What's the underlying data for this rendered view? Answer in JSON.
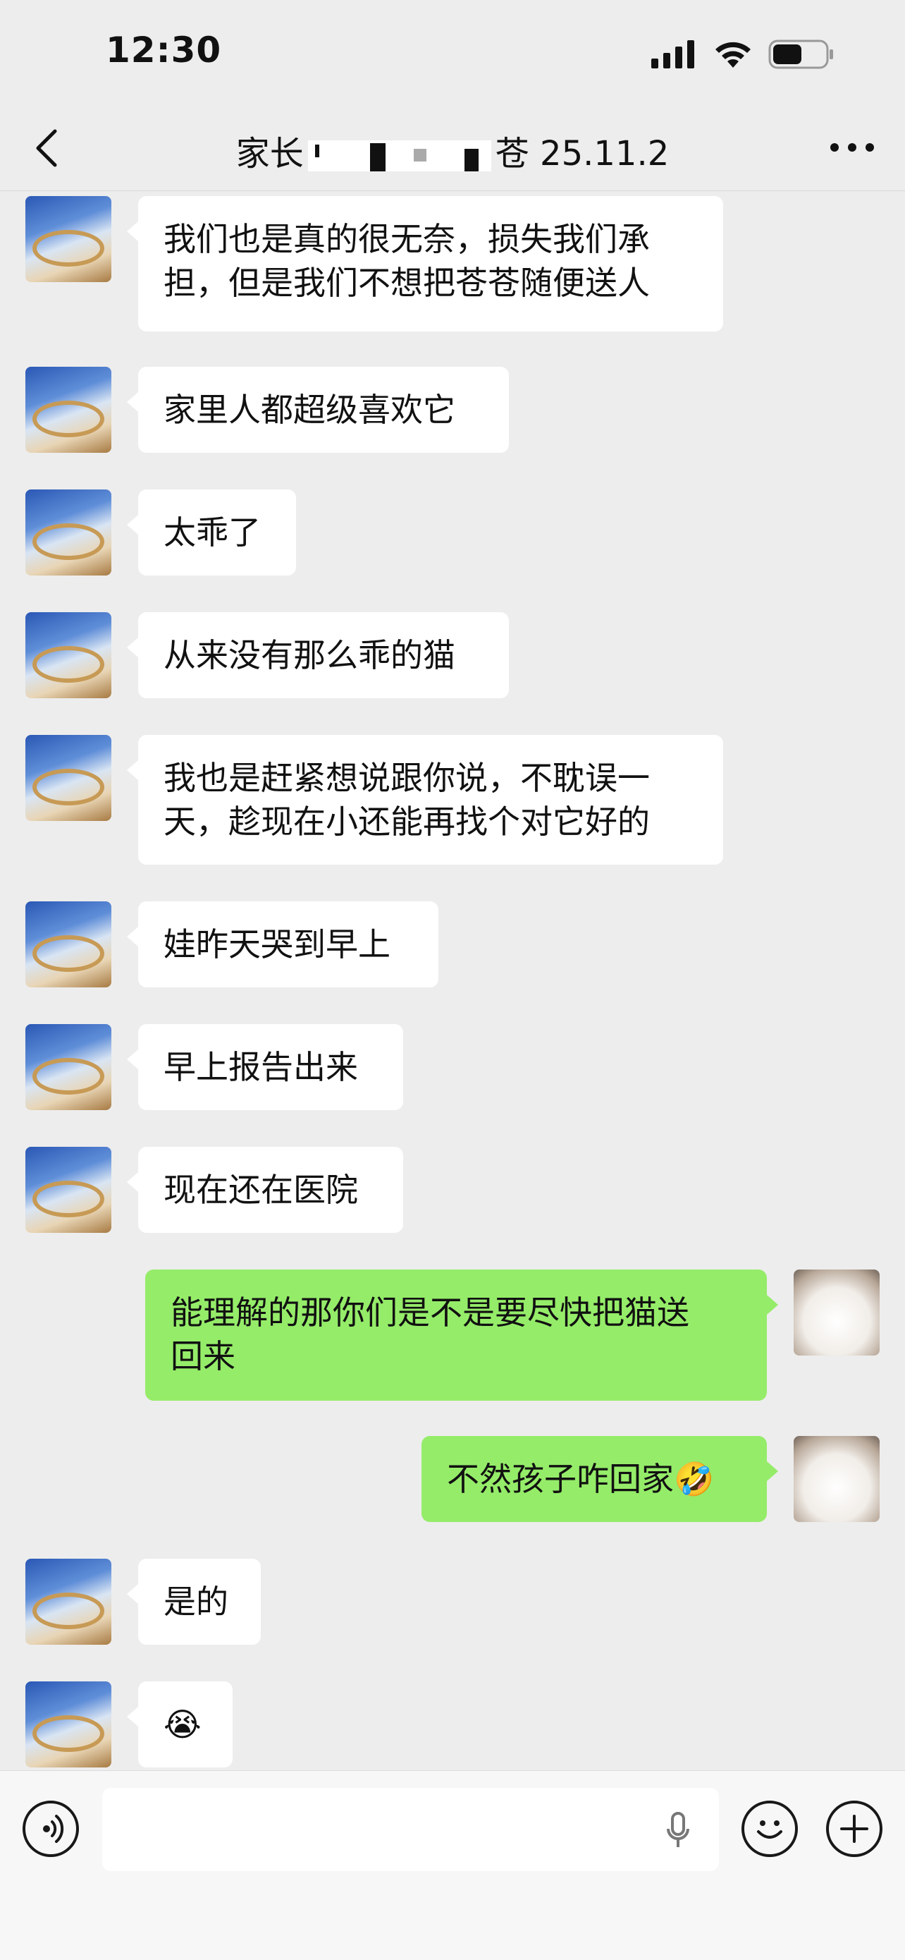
{
  "status_bar": {
    "time": "12:30"
  },
  "nav": {
    "title_prefix": "家长",
    "title_suffix": "苍 25.11.2"
  },
  "messages": [
    {
      "side": "in",
      "text": "我们也是真的很无奈，损失我们承\n担，但是我们不想把苍苍随便送人"
    },
    {
      "side": "in",
      "text": "家里人都超级喜欢它"
    },
    {
      "side": "in",
      "text": "太乖了"
    },
    {
      "side": "in",
      "text": "从来没有那么乖的猫"
    },
    {
      "side": "in",
      "text": "我也是赶紧想说跟你说，不耽误一\n天，趁现在小还能再找个对它好的"
    },
    {
      "side": "in",
      "text": "娃昨天哭到早上"
    },
    {
      "side": "in",
      "text": "早上报告出来"
    },
    {
      "side": "in",
      "text": "现在还在医院"
    },
    {
      "side": "out",
      "text": "能理解的那你们是不是要尽快把猫送\n回来"
    },
    {
      "side": "out",
      "text": "不然孩子咋回家🤣"
    },
    {
      "side": "in",
      "text": "是的"
    },
    {
      "side": "in",
      "text": "😭"
    }
  ],
  "input": {
    "placeholder": ""
  }
}
